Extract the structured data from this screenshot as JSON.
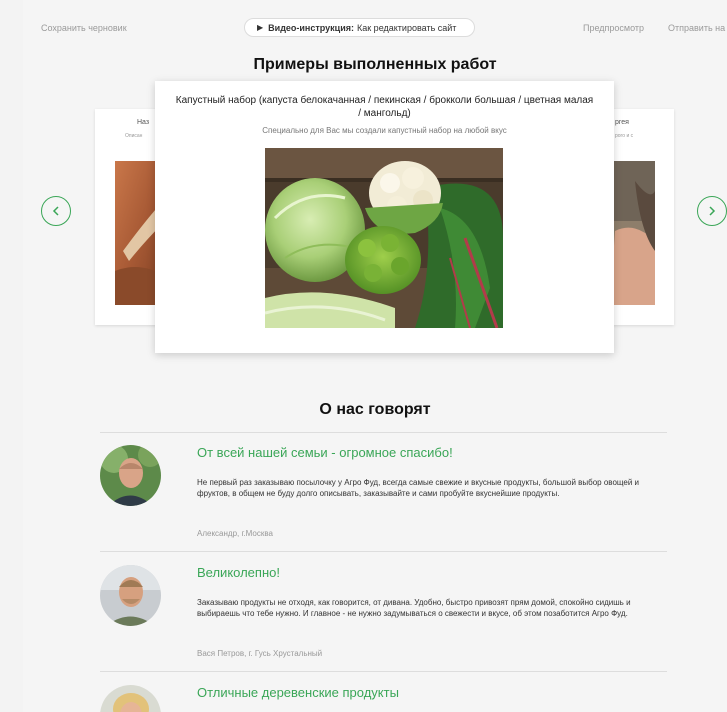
{
  "toolbar": {
    "save_draft": "Сохранить черновик",
    "video_label": "Видео-инструкция:",
    "video_text": "Как редактировать сайт",
    "preview": "Предпросмотр",
    "send": "Отправить на"
  },
  "works": {
    "title": "Примеры выполненных работ",
    "main_card": {
      "title": "Капустный набор (капуста белокачанная / пекинская / брокколи большая / цветная малая / мангольд)",
      "subtitle": "Специально для Вас мы создали капустный набор на любой вкус"
    },
    "left_card": {
      "title": "Наз",
      "subtitle": "Описан"
    },
    "right_card": {
      "title": "ргея",
      "subtitle": "рого и с"
    }
  },
  "reviews": {
    "title": "О нас говорят",
    "items": [
      {
        "title": "От всей нашей семьи - огромное спасибо!",
        "text": "Не первый раз заказываю посылочку у Агро Фуд, всегда самые свежие и вкусные продукты, большой выбор овощей и фруктов, в общем не буду долго описывать, заказывайте и сами пробуйте вкуснейшие продукты.",
        "author": "Александр, г.Москва"
      },
      {
        "title": "Великолепно!",
        "text": "Заказываю продукты не отходя, как говорится, от дивана. Удобно, быстро привозят прям домой, спокойно сидишь и выбираешь что тебе нужно. И главное - не нужно задумываться о свежести и вкусе, об этом позаботится Агро Фуд.",
        "author": "Вася Петров, г. Гусь Хрустальный"
      },
      {
        "title": "Отличные деревенские продукты",
        "text": "",
        "author": ""
      }
    ]
  },
  "colors": {
    "accent": "#3aa657",
    "background": "#f5f5f5"
  }
}
